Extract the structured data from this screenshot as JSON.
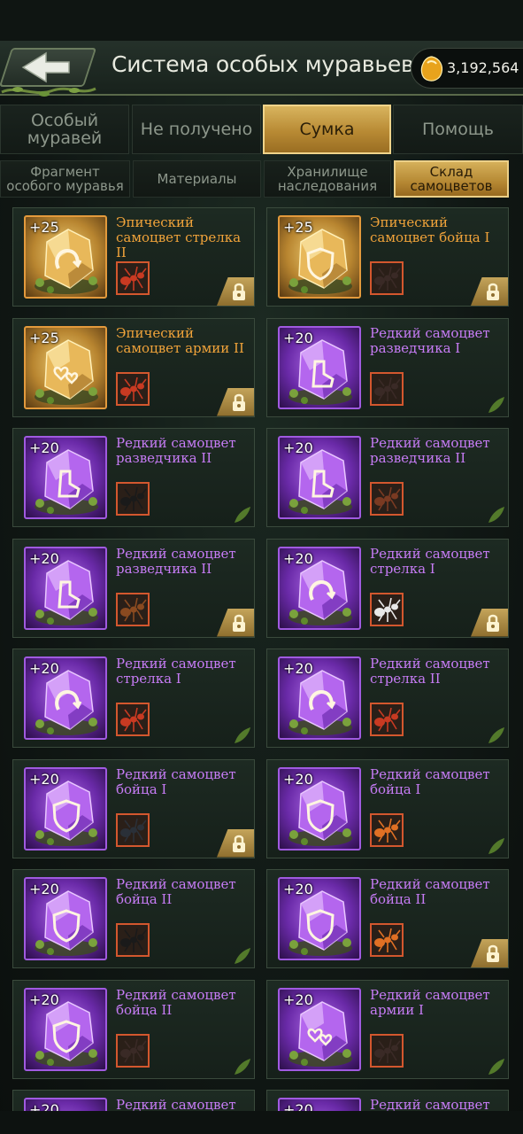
{
  "header": {
    "title": "Система особых муравьев",
    "coins": "3,192,564",
    "back_icon": "back-arrow-icon",
    "coin_icon": "amber-coin-icon"
  },
  "main_tabs": [
    {
      "label": "Особый\nмуравей",
      "active": false
    },
    {
      "label": "Не получено",
      "active": false
    },
    {
      "label": "Сумка",
      "active": true
    },
    {
      "label": "Помощь",
      "active": false
    }
  ],
  "sub_tabs": [
    {
      "label": "Фрагмент\nособого муравья",
      "active": false
    },
    {
      "label": "Материалы",
      "active": false
    },
    {
      "label": "Хранилище\nнаследования",
      "active": false
    },
    {
      "label": "Склад\nсамоцветов",
      "active": true
    }
  ],
  "colors": {
    "epic": "#f0a33a",
    "rare": "#c77cf6",
    "active_tab": "#c89a44"
  },
  "gems": [
    {
      "qty": "+25",
      "name": "Эпический самоцвет стрелка II",
      "rarity": "epic",
      "symbol": "ring",
      "ant": "red-ant-icon",
      "locked": true
    },
    {
      "qty": "+25",
      "name": "Эпический самоцвет бойца I",
      "rarity": "epic",
      "symbol": "shield",
      "ant": "dark-ant-icon",
      "locked": true
    },
    {
      "qty": "+25",
      "name": "Эпический самоцвет армии II",
      "rarity": "epic",
      "symbol": "hearts",
      "ant": "red-ant-icon",
      "locked": true
    },
    {
      "qty": "+20",
      "name": "Редкий самоцвет разведчика I",
      "rarity": "rare",
      "symbol": "boot",
      "ant": "dark-ant-icon",
      "locked": false
    },
    {
      "qty": "+20",
      "name": "Редкий самоцвет разведчика II",
      "rarity": "rare",
      "symbol": "boot",
      "ant": "black-ant-icon",
      "locked": false
    },
    {
      "qty": "+20",
      "name": "Редкий самоцвет разведчика II",
      "rarity": "rare",
      "symbol": "boot",
      "ant": "brown-spider-icon",
      "locked": false
    },
    {
      "qty": "+20",
      "name": "Редкий самоцвет разведчика II",
      "rarity": "rare",
      "symbol": "boot",
      "ant": "brown-ant-icon",
      "locked": true
    },
    {
      "qty": "+20",
      "name": "Редкий самоцвет стрелка I",
      "rarity": "rare",
      "symbol": "ring",
      "ant": "white-ant-icon",
      "locked": true
    },
    {
      "qty": "+20",
      "name": "Редкий самоцвет стрелка I",
      "rarity": "rare",
      "symbol": "ring",
      "ant": "red-ant-icon",
      "locked": false
    },
    {
      "qty": "+20",
      "name": "Редкий самоцвет стрелка II",
      "rarity": "rare",
      "symbol": "ring",
      "ant": "red-ant-icon",
      "locked": false
    },
    {
      "qty": "+20",
      "name": "Редкий самоцвет бойца I",
      "rarity": "rare",
      "symbol": "shield",
      "ant": "beetle-icon",
      "locked": true
    },
    {
      "qty": "+20",
      "name": "Редкий самоцвет бойца I",
      "rarity": "rare",
      "symbol": "shield",
      "ant": "orange-ant-icon",
      "locked": false
    },
    {
      "qty": "+20",
      "name": "Редкий самоцвет бойца II",
      "rarity": "rare",
      "symbol": "shield",
      "ant": "black-ant-icon",
      "locked": false
    },
    {
      "qty": "+20",
      "name": "Редкий самоцвет бойца II",
      "rarity": "rare",
      "symbol": "shield",
      "ant": "orange-ant-icon",
      "locked": true
    },
    {
      "qty": "+20",
      "name": "Редкий самоцвет бойца II",
      "rarity": "rare",
      "symbol": "shield",
      "ant": "dark-ant-icon",
      "locked": false
    },
    {
      "qty": "+20",
      "name": "Редкий самоцвет армии I",
      "rarity": "rare",
      "symbol": "hearts",
      "ant": "dark-ant-icon",
      "locked": false
    },
    {
      "qty": "+20",
      "name": "Редкий самоцвет",
      "rarity": "rare",
      "symbol": "ring",
      "ant": "dark-ant-icon",
      "locked": false
    },
    {
      "qty": "+20",
      "name": "Редкий самоцвет",
      "rarity": "rare",
      "symbol": "ring",
      "ant": "dark-ant-icon",
      "locked": false
    }
  ]
}
